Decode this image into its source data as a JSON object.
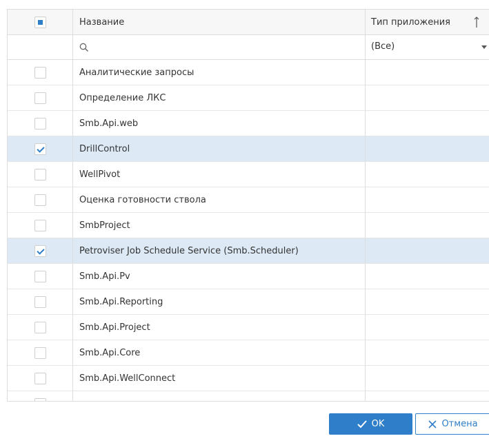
{
  "grid": {
    "columns": {
      "name_header": "Название",
      "type_header": "Тип приложения"
    },
    "filter": {
      "type_value": "(Все)"
    },
    "rows": [
      {
        "name": "Аналитические запросы",
        "checked": false
      },
      {
        "name": "Определение ЛКС",
        "checked": false
      },
      {
        "name": "Smb.Api.web",
        "checked": false
      },
      {
        "name": "DrillControl",
        "checked": true
      },
      {
        "name": "WellPivot",
        "checked": false
      },
      {
        "name": "Оценка готовности ствола",
        "checked": false
      },
      {
        "name": "SmbProject",
        "checked": false
      },
      {
        "name": "Petroviser Job Schedule Service (Smb.Scheduler)",
        "checked": true
      },
      {
        "name": "Smb.Api.Pv",
        "checked": false
      },
      {
        "name": "Smb.Api.Reporting",
        "checked": false
      },
      {
        "name": "Smb.Api.Project",
        "checked": false
      },
      {
        "name": "Smb.Api.Core",
        "checked": false
      },
      {
        "name": "Smb.Api.WellConnect",
        "checked": false
      },
      {
        "name": "",
        "checked": false
      }
    ]
  },
  "buttons": {
    "ok_label": "OK",
    "cancel_label": "Отмена"
  },
  "colors": {
    "accent": "#2f7ec9",
    "selected_row": "#dde9f5",
    "border": "#dddddd",
    "header_bg": "#f7f7f7"
  },
  "icons": {
    "sort": "sort-arrow-up-icon",
    "search": "search-icon",
    "dropdown": "chevron-down-icon",
    "ok": "check-icon",
    "cancel": "close-icon"
  }
}
